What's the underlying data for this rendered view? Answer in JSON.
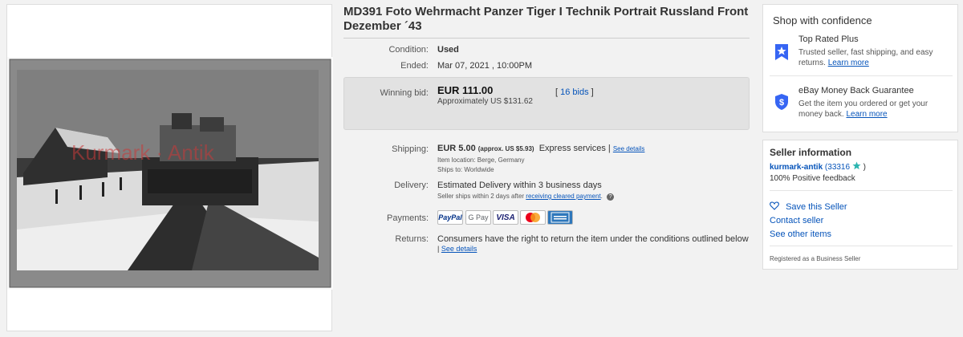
{
  "listing": {
    "title": "MD391 Foto Wehrmacht Panzer Tiger I Technik Portrait Russland Front Dezember ´43",
    "watermark": "Kurmark · Antik",
    "condition_label": "Condition:",
    "condition_value": "Used",
    "ended_label": "Ended:",
    "ended_value": "Mar 07, 2021 , 10:00PM",
    "winning_bid_label": "Winning bid:",
    "winning_bid_value": "EUR 111.00",
    "approx_value": "Approximately US $131.62",
    "bids_open": "[",
    "bids_link": "16 bids",
    "bids_close": "]",
    "shipping_label": "Shipping:",
    "shipping_cost": "EUR 5.00",
    "shipping_approx": "(approx. US $5.93)",
    "shipping_service": "Express services",
    "shipping_sep": "|",
    "shipping_details": "See details",
    "item_location": "Item location:  Berge, Germany",
    "ships_to": "Ships to:  Worldwide",
    "delivery_label": "Delivery:",
    "delivery_value": "Estimated Delivery within 3 business days",
    "delivery_note_prefix": "Seller ships within 2 days after ",
    "delivery_note_link": "receiving cleared payment",
    "delivery_note_suffix": ".",
    "payments_label": "Payments:",
    "payment_methods": [
      "PayPal",
      "G Pay",
      "VISA",
      "Mastercard",
      "American Express"
    ],
    "returns_label": "Returns:",
    "returns_value": "Consumers have the right to return the item under the conditions outlined below",
    "returns_sep": "|",
    "returns_details": "See details"
  },
  "confidence": {
    "heading": "Shop with confidence",
    "top_rated_title": "Top Rated Plus",
    "top_rated_desc": "Trusted seller, fast shipping, and easy returns.",
    "top_rated_link": "Learn more",
    "money_back_title": "eBay Money Back Guarantee",
    "money_back_desc": "Get the item you ordered or get your money back.",
    "money_back_link": "Learn more"
  },
  "seller": {
    "heading": "Seller information",
    "name": "kurmark-antik",
    "feedback_count": "(33316",
    "feedback_close": ")",
    "positive": "100% Positive feedback",
    "save_seller": "Save this Seller",
    "contact": "Contact seller",
    "other_items": "See other items",
    "registered": "Registered as a Business Seller"
  },
  "colors": {
    "link": "#0654ba",
    "bid_box": "#e2e2e2",
    "star": "#3665f3",
    "paypal_blue": "#003087",
    "visa_blue": "#1a1f71",
    "amex_blue": "#2e77bb",
    "mastercard_red": "#eb001b",
    "mastercard_orange": "#f79e1b"
  },
  "icons": [
    "top-rated-icon",
    "money-back-shield-icon",
    "feedback-star-icon",
    "heart-icon",
    "help-icon"
  ]
}
